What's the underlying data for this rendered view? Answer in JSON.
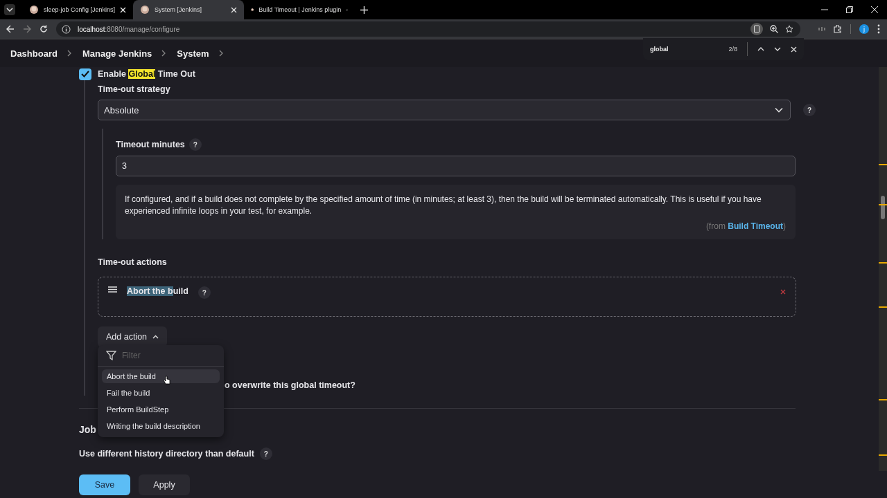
{
  "browser": {
    "tabs": [
      {
        "title": "sleep-job Config [Jenkins]",
        "selected": false
      },
      {
        "title": "System [Jenkins]",
        "selected": true
      },
      {
        "title": "Build Timeout | Jenkins plugin",
        "selected": false
      }
    ],
    "url_host": "localhost",
    "url_path": ":8080/manage/configure",
    "profile_initial": "j"
  },
  "find_bar": {
    "query": "global",
    "count": "2/8"
  },
  "breadcrumbs": [
    "Dashboard",
    "Manage Jenkins",
    "System"
  ],
  "enable": {
    "checked": true,
    "label_parts": [
      {
        "text": "Enable ",
        "highlight": false
      },
      {
        "text": "Global",
        "highlight": true
      },
      {
        "text": " Time Out",
        "highlight": false
      }
    ]
  },
  "strategy": {
    "label": "Time-out strategy",
    "value": "Absolute",
    "help": "?"
  },
  "timeout": {
    "label": "Timeout minutes",
    "help": "?",
    "value": "3",
    "description": "If configured, and if a build does not complete by the specified amount of time (in minutes; at least 3), then the build will be terminated automatically. This is useful if you have experienced infinite loops in your test, for example.",
    "from_open": "(from ",
    "from_link": "Build Timeout",
    "from_close": ")"
  },
  "actions": {
    "label": "Time-out actions",
    "items": [
      {
        "title_parts": [
          {
            "text": "Abort the b",
            "selected": true
          },
          {
            "text": "uild",
            "selected": false
          }
        ],
        "help": "?"
      }
    ],
    "add_label": "Add action",
    "menu_open": true
  },
  "menu": {
    "filter_placeholder": "Filter",
    "items": [
      {
        "label": "Abort the build",
        "hovered": true
      },
      {
        "label": "Fail the build",
        "hovered": false
      },
      {
        "label": "Perform BuildStep",
        "hovered": false
      },
      {
        "label": "Writing the build description",
        "hovered": false
      }
    ]
  },
  "overwrite_question": "o overwrite this global timeout?",
  "job_heading": "Job",
  "history_label": "Use different history directory than default",
  "history_help": "?",
  "buttons": [
    {
      "label": "Save",
      "kind": "primary"
    },
    {
      "label": "Apply",
      "kind": "secondary"
    }
  ]
}
